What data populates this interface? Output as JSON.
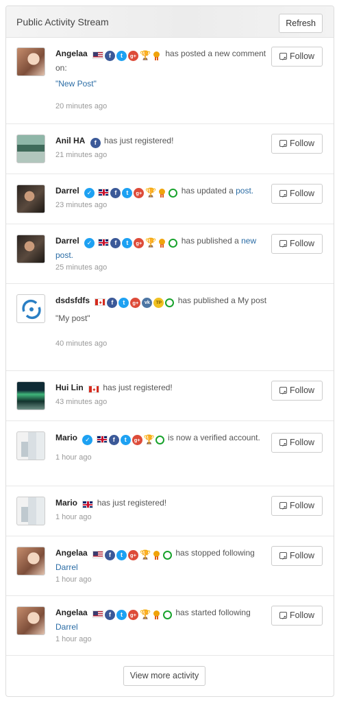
{
  "panel": {
    "title": "Public Activity Stream",
    "refresh_label": "Refresh"
  },
  "follow_label": "Follow",
  "more_label": "View more activity",
  "items": [
    {
      "user": "Angelaa",
      "pre": "has posted a new comment on:",
      "link": "",
      "post": "",
      "quote": "\"New Post\"",
      "time": "20 minutes ago"
    },
    {
      "user": "Anil HA",
      "pre": "has just registered!",
      "link": "",
      "post": "",
      "quote": "",
      "time": "21 minutes ago"
    },
    {
      "user": "Darrel",
      "pre": "has updated a ",
      "link": "post.",
      "post": "",
      "quote": "",
      "time": "23 minutes ago"
    },
    {
      "user": "Darrel",
      "pre": "has published a ",
      "link": "new post.",
      "post": "",
      "quote": "",
      "time": "25 minutes ago"
    },
    {
      "user": "dsdsfdfs",
      "pre": "has published a My post",
      "link": "",
      "post": "",
      "quote": "\"My post\"",
      "time": "40 minutes ago"
    },
    {
      "user": "Hui Lin",
      "pre": "has just registered!",
      "link": "",
      "post": "",
      "quote": "",
      "time": "43 minutes ago"
    },
    {
      "user": "Mario",
      "pre": "is now a verified account.",
      "link": "",
      "post": "",
      "quote": "",
      "time": "1 hour ago"
    },
    {
      "user": "Mario",
      "pre": "has just registered!",
      "link": "",
      "post": "",
      "quote": "",
      "time": "1 hour ago"
    },
    {
      "user": "Angelaa",
      "pre": "has stopped following ",
      "link": "Darrel",
      "post": "",
      "quote": "",
      "time": "1 hour ago"
    },
    {
      "user": "Angelaa",
      "pre": "has started following ",
      "link": "Darrel",
      "post": "",
      "quote": "",
      "time": "1 hour ago"
    }
  ]
}
